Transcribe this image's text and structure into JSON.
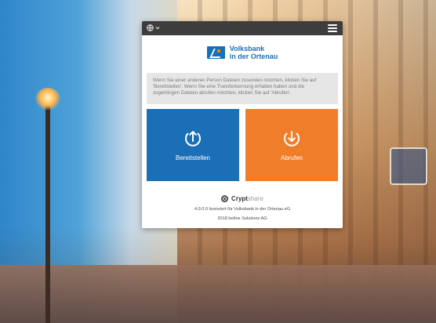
{
  "app": {
    "brand": {
      "line1": "Volksbank",
      "line2": "in der Ortenau"
    },
    "topbar": {
      "language_icon": "globe-icon",
      "language_chevron": "chevron-down-icon",
      "menu_icon": "hamburger-menu-icon"
    },
    "info_text": "Wenn Sie einer anderen Person Dateien zusenden möchten, klicken Sie auf 'Bereitstellen'. Wenn Sie eine Transferkennung erhalten haben und die zugehörigen Dateien abrufen möchten, klicken Sie auf 'Abrufen'.",
    "actions": [
      {
        "label": "Bereitstellen",
        "icon": "upload-icon"
      },
      {
        "label": "Abrufen",
        "icon": "download-icon"
      }
    ],
    "footer": {
      "product_name_bold": "Crypt",
      "product_name_light": "share",
      "license": "4.0.0.0 lizenziert für Volksbank in der Ortenau eG",
      "copyright": "2018 befine Solutions AG"
    },
    "colors": {
      "blue": "#1a6fb6",
      "orange": "#f07d2a",
      "topbar": "#3d3d3d",
      "info_bg": "#e6e6e6"
    }
  }
}
